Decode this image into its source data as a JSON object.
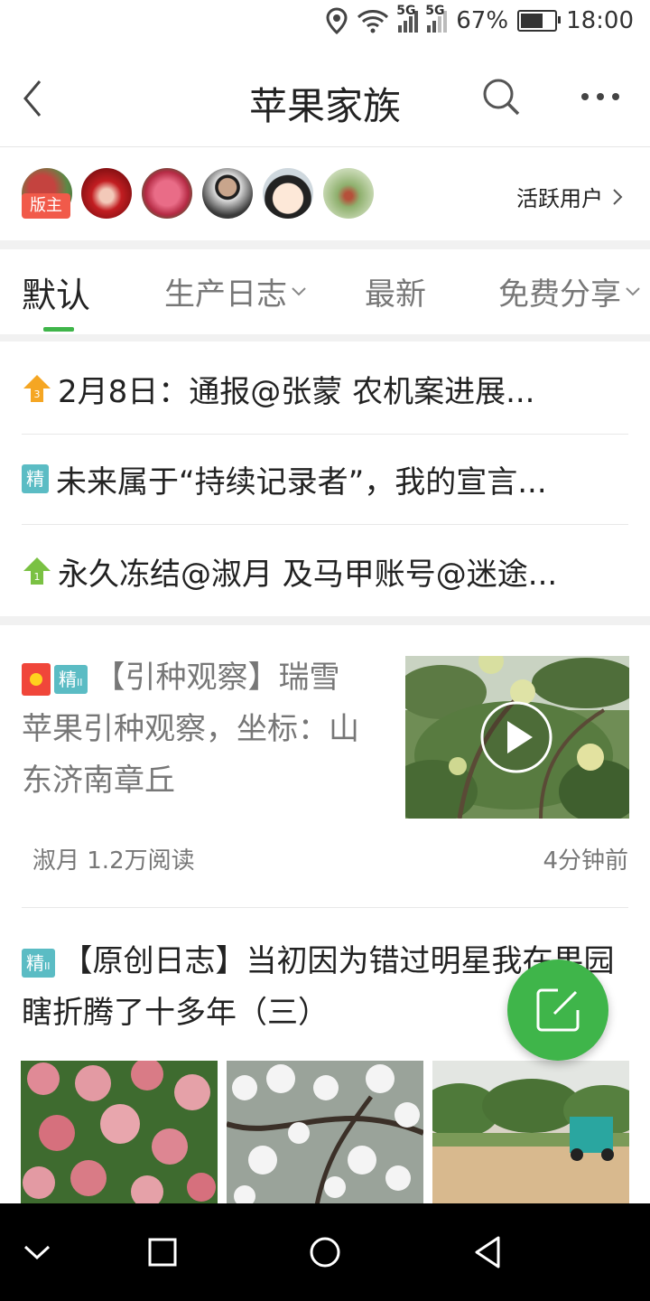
{
  "status_bar": {
    "battery": "67%",
    "time": "18:00",
    "network_a": "5G",
    "network_b": "5G",
    "battery_level": 0.67
  },
  "header": {
    "title": "苹果家族"
  },
  "active_users": {
    "owner_badge": "版主",
    "label": "活跃用户"
  },
  "tabs": [
    {
      "label": "默认",
      "active": true
    },
    {
      "label": "生产日志",
      "dropdown": true
    },
    {
      "label": "最新"
    },
    {
      "label": "免费分享",
      "dropdown": true
    }
  ],
  "pinned": [
    {
      "badge": "3",
      "text": "2月8日：通报@张蒙 农机案进展..."
    },
    {
      "badge": "精",
      "text": "未来属于“持续记录者”，我的宣言..."
    },
    {
      "badge": "1",
      "text": "永久冻结@淑月 及马甲账号@迷途..."
    }
  ],
  "posts": [
    {
      "tag": "精",
      "tag_sub": "II",
      "title": "【引种观察】瑞雪苹果引种观察，坐标：山东济南章丘",
      "meta": "淑月 1.2万阅读",
      "time": "4分钟前"
    },
    {
      "tag": "精",
      "tag_sub": "II",
      "title": "【原创日志】当初因为错过明星我在果园瞎折腾了十多年（三）"
    }
  ],
  "colors": {
    "accent": "#3fb54a",
    "jing_tag": "#5bbcc4",
    "owner_badge": "#f15a4a",
    "top_orange": "#f5a623"
  }
}
